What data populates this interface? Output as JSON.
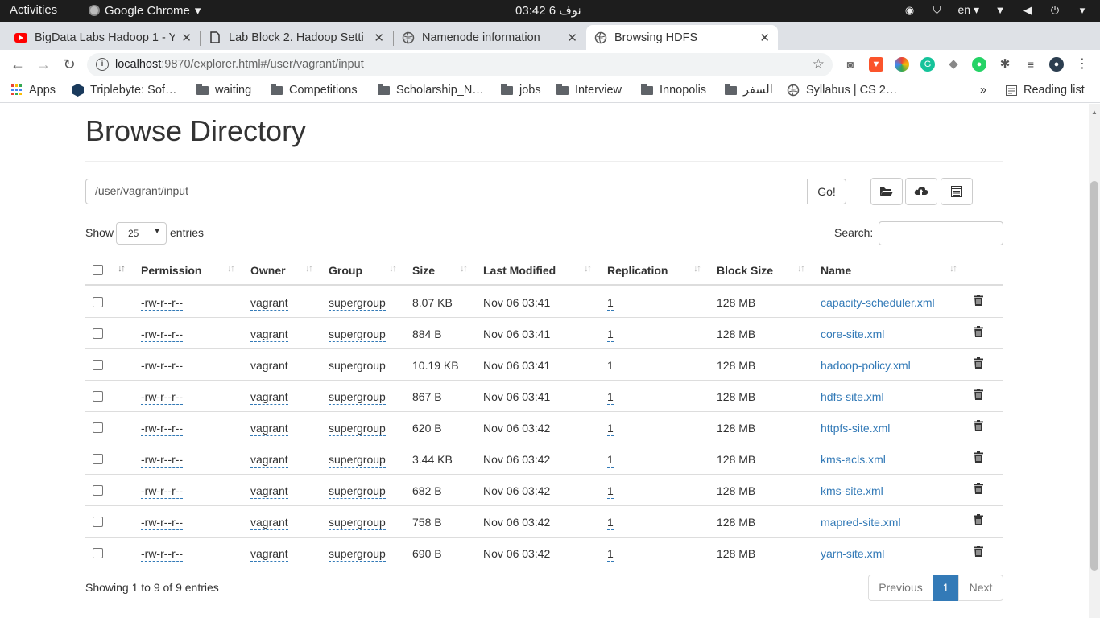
{
  "system": {
    "activities": "Activities",
    "app_name": "Google Chrome",
    "clock": "نوف 6  03:42",
    "lang": "en"
  },
  "tabs": [
    {
      "title": "BigData Labs Hadoop 1 - Y"
    },
    {
      "title": "Lab Block 2. Hadoop Setti"
    },
    {
      "title": "Namenode information"
    },
    {
      "title": "Browsing HDFS"
    }
  ],
  "address": {
    "host": "localhost",
    "rest": ":9870/explorer.html#/user/vagrant/input"
  },
  "bookmarks": [
    "Apps",
    "Triplebyte: Sof…",
    "waiting",
    "Competitions",
    "Scholarship_N…",
    "jobs",
    "Interview",
    "Innopolis",
    "السفر",
    "Syllabus | CS 2…"
  ],
  "bookmarks_more": "»",
  "reading_list": "Reading list",
  "page": {
    "heading": "Browse Directory",
    "path_value": "/user/vagrant/input",
    "go_label": "Go!",
    "show_label": "Show",
    "page_length": "25",
    "entries_label": "entries",
    "search_label": "Search:",
    "columns": [
      "Permission",
      "Owner",
      "Group",
      "Size",
      "Last Modified",
      "Replication",
      "Block Size",
      "Name"
    ],
    "rows": [
      {
        "permission": "-rw-r--r--",
        "owner": "vagrant",
        "group": "supergroup",
        "size": "8.07 KB",
        "modified": "Nov 06 03:41",
        "replication": "1",
        "block": "128 MB",
        "name": "capacity-scheduler.xml"
      },
      {
        "permission": "-rw-r--r--",
        "owner": "vagrant",
        "group": "supergroup",
        "size": "884 B",
        "modified": "Nov 06 03:41",
        "replication": "1",
        "block": "128 MB",
        "name": "core-site.xml"
      },
      {
        "permission": "-rw-r--r--",
        "owner": "vagrant",
        "group": "supergroup",
        "size": "10.19 KB",
        "modified": "Nov 06 03:41",
        "replication": "1",
        "block": "128 MB",
        "name": "hadoop-policy.xml"
      },
      {
        "permission": "-rw-r--r--",
        "owner": "vagrant",
        "group": "supergroup",
        "size": "867 B",
        "modified": "Nov 06 03:41",
        "replication": "1",
        "block": "128 MB",
        "name": "hdfs-site.xml"
      },
      {
        "permission": "-rw-r--r--",
        "owner": "vagrant",
        "group": "supergroup",
        "size": "620 B",
        "modified": "Nov 06 03:42",
        "replication": "1",
        "block": "128 MB",
        "name": "httpfs-site.xml"
      },
      {
        "permission": "-rw-r--r--",
        "owner": "vagrant",
        "group": "supergroup",
        "size": "3.44 KB",
        "modified": "Nov 06 03:42",
        "replication": "1",
        "block": "128 MB",
        "name": "kms-acls.xml"
      },
      {
        "permission": "-rw-r--r--",
        "owner": "vagrant",
        "group": "supergroup",
        "size": "682 B",
        "modified": "Nov 06 03:42",
        "replication": "1",
        "block": "128 MB",
        "name": "kms-site.xml"
      },
      {
        "permission": "-rw-r--r--",
        "owner": "vagrant",
        "group": "supergroup",
        "size": "758 B",
        "modified": "Nov 06 03:42",
        "replication": "1",
        "block": "128 MB",
        "name": "mapred-site.xml"
      },
      {
        "permission": "-rw-r--r--",
        "owner": "vagrant",
        "group": "supergroup",
        "size": "690 B",
        "modified": "Nov 06 03:42",
        "replication": "1",
        "block": "128 MB",
        "name": "yarn-site.xml"
      }
    ],
    "info": "Showing 1 to 9 of 9 entries",
    "pagination": {
      "previous": "Previous",
      "current": "1",
      "next": "Next"
    }
  },
  "colors": {
    "link": "#337ab7",
    "active_page": "#337ab7",
    "topbar": "#1d1d1d",
    "tabstrip": "#dee1e6"
  }
}
